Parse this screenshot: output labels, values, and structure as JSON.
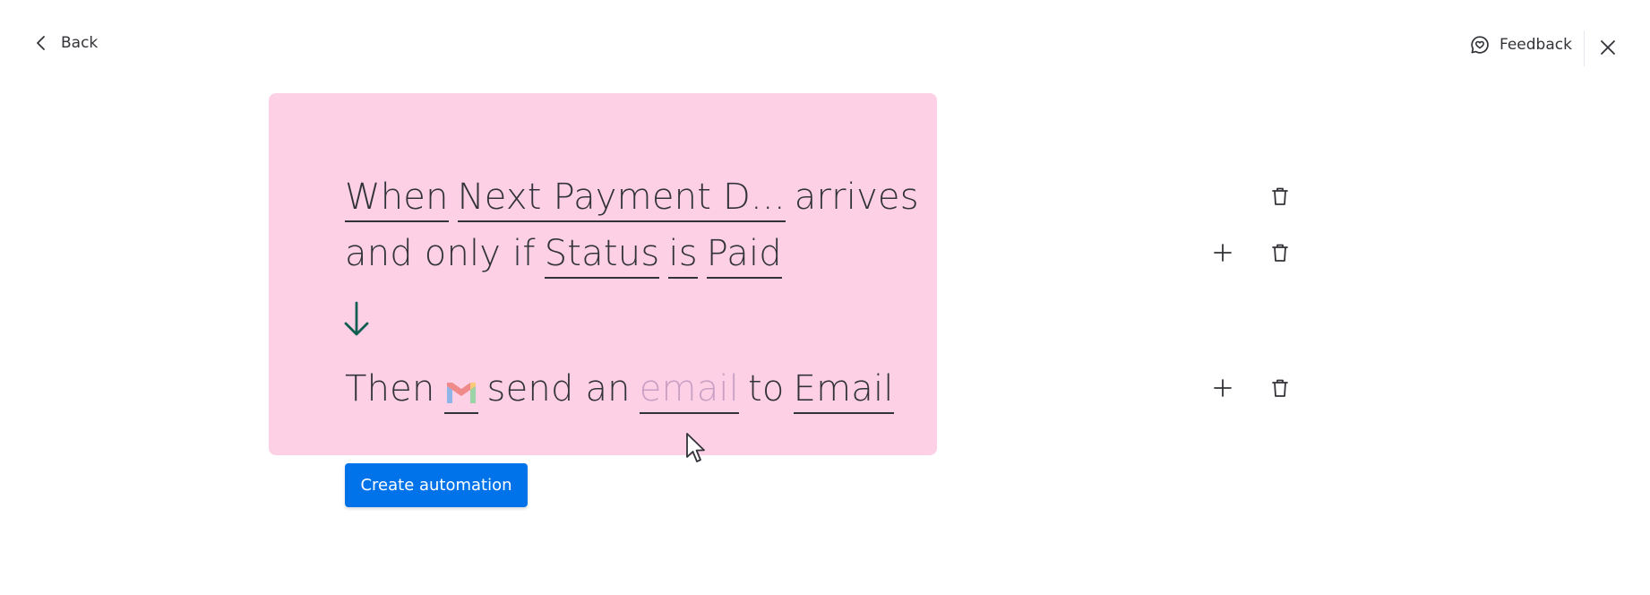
{
  "nav": {
    "back_label": "Back",
    "feedback_label": "Feedback"
  },
  "recipe": {
    "trigger": {
      "when": "When",
      "column": "Next Payment D...",
      "event": "arrives"
    },
    "condition": {
      "prefix": "and only if",
      "column": "Status",
      "operator": "is",
      "value": "Paid"
    },
    "action": {
      "then": "Then",
      "integration_icon": "gmail-icon",
      "verb": "send an",
      "item_placeholder": "email",
      "to": "to",
      "target": "Email"
    }
  },
  "actions": {
    "create_label": "Create automation"
  },
  "colors": {
    "card_background": "#fdd0e6",
    "primary_button": "#0073ea",
    "arrow": "#0f5e4f",
    "placeholder_text": "#c9a0c4"
  }
}
